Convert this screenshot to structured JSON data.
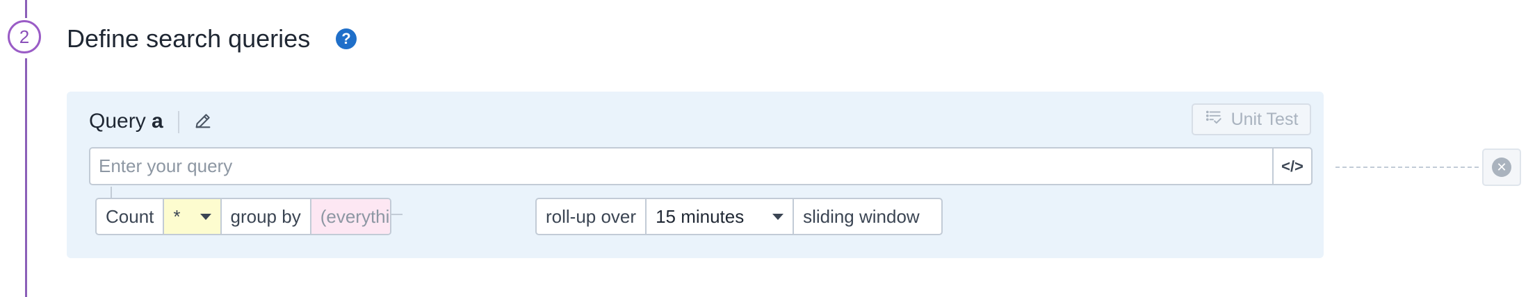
{
  "step": {
    "number": "2",
    "title": "Define search queries",
    "help_icon": "question-circle-icon"
  },
  "query": {
    "label": "Query",
    "letter": "a",
    "edit_icon": "pencil-icon",
    "unit_test_label": "Unit Test",
    "unit_test_icon": "list-check-icon",
    "input_placeholder": "Enter your query",
    "input_value": "",
    "code_toggle_label": "</>"
  },
  "aggregation": {
    "function_label": "Count",
    "measure_value": "*",
    "group_by_label": "group by",
    "group_by_value": "(everything)",
    "rollup_label": "roll-up over",
    "rollup_value": "15 minutes",
    "window_label": "sliding window"
  },
  "actions": {
    "remove_icon": "close-circle-icon"
  },
  "colors": {
    "timeline": "#8b5fb8",
    "help": "#1f6fc9",
    "panel_bg": "#eaf3fb",
    "measure_bg": "#fdfccf",
    "group_by_bg": "#fde7f3"
  }
}
